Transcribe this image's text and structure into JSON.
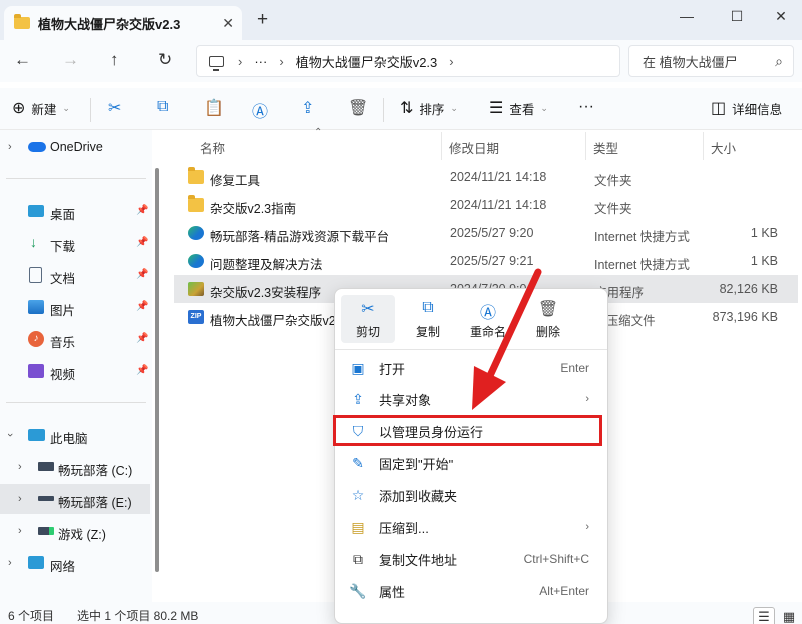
{
  "window": {
    "tab_title": "植物大战僵尸杂交版v2.3",
    "tab_close": "✕",
    "tab_add": "+",
    "minimize": "—",
    "maximize": "☐",
    "close": "✕"
  },
  "address": {
    "path_prefix": "···",
    "path": "植物大战僵尸杂交版v2.3",
    "search_placeholder": "在 植物大战僵尸"
  },
  "toolbar": {
    "new_label": "新建",
    "sort_label": "排序",
    "view_label": "查看",
    "more_label": "···",
    "details_label": "详细信息"
  },
  "sidebar": {
    "onedrive": "OneDrive",
    "quick": [
      {
        "label": "桌面"
      },
      {
        "label": "下载"
      },
      {
        "label": "文档"
      },
      {
        "label": "图片"
      },
      {
        "label": "音乐"
      },
      {
        "label": "视频"
      }
    ],
    "this_pc": "此电脑",
    "drives": [
      {
        "label": "畅玩部落 (C:)"
      },
      {
        "label": "畅玩部落 (E:)"
      },
      {
        "label": "游戏 (Z:)"
      }
    ],
    "network": "网络"
  },
  "columns": {
    "name": "名称",
    "date": "修改日期",
    "type": "类型",
    "size": "大小"
  },
  "files": [
    {
      "name": "修复工具",
      "date": "2024/11/21 14:18",
      "type": "文件夹",
      "size": "",
      "icon": "folder"
    },
    {
      "name": "杂交版v2.3指南",
      "date": "2024/11/21 14:18",
      "type": "文件夹",
      "size": "",
      "icon": "folder"
    },
    {
      "name": "畅玩部落-精品游戏资源下载平台",
      "date": "2025/5/27 9:20",
      "type": "Internet 快捷方式",
      "size": "1 KB",
      "icon": "link"
    },
    {
      "name": "问题整理及解决方法",
      "date": "2025/5/27 9:21",
      "type": "Internet 快捷方式",
      "size": "1 KB",
      "icon": "link"
    },
    {
      "name": "杂交版v2.3安装程序",
      "date": "2024/7/20 9:0",
      "type": "应用程序",
      "size": "82,126 KB",
      "icon": "app"
    },
    {
      "name": "植物大战僵尸杂交版v2.",
      "date": "",
      "type": "P 压缩文件",
      "size": "873,196 KB",
      "icon": "zip"
    }
  ],
  "context_menu": {
    "cut": "剪切",
    "copy": "复制",
    "rename": "重命名",
    "delete": "删除",
    "items": [
      {
        "label": "打开",
        "shortcut": "Enter"
      },
      {
        "label": "共享对象",
        "shortcut": ""
      },
      {
        "label": "以管理员身份运行",
        "shortcut": ""
      },
      {
        "label": "固定到\"开始\"",
        "shortcut": ""
      },
      {
        "label": "添加到收藏夹",
        "shortcut": ""
      },
      {
        "label": "压缩到...",
        "shortcut": ""
      },
      {
        "label": "复制文件地址",
        "shortcut": "Ctrl+Shift+C"
      },
      {
        "label": "属性",
        "shortcut": "Alt+Enter"
      }
    ]
  },
  "status": {
    "count": "6 个项目",
    "selected": "选中 1 个项目  80.2 MB"
  },
  "colors": {
    "accent": "#1976d2",
    "highlight": "#e02020",
    "folder": "#f3c244"
  }
}
